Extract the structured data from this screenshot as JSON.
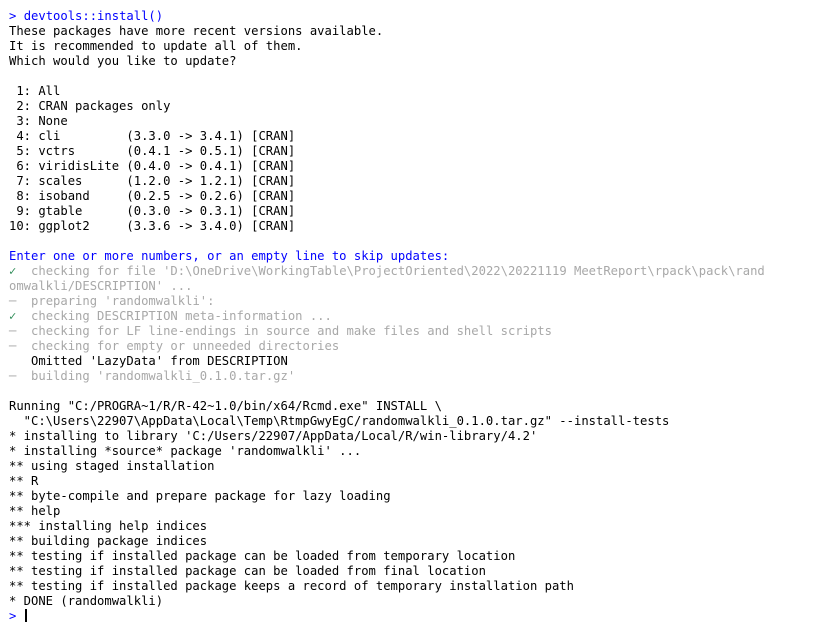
{
  "console": {
    "command_prompt": "> ",
    "command": "devtools::install()",
    "intro_lines": [
      "These packages have more recent versions available.",
      "It is recommended to update all of them.",
      "Which would you like to update?"
    ],
    "options": [
      " 1: All",
      " 2: CRAN packages only",
      " 3: None",
      " 4: cli         (3.3.0 -> 3.4.1) [CRAN]",
      " 5: vctrs       (0.4.1 -> 0.5.1) [CRAN]",
      " 6: viridisLite (0.4.0 -> 0.4.1) [CRAN]",
      " 7: scales      (1.2.0 -> 1.2.1) [CRAN]",
      " 8: isoband     (0.2.5 -> 0.2.6) [CRAN]",
      " 9: gtable      (0.3.0 -> 0.3.1) [CRAN]",
      "10: ggplot2     (3.3.6 -> 3.4.0) [CRAN]"
    ],
    "enter_prompt": "Enter one or more numbers, or an empty line to skip updates:",
    "build_steps": {
      "s1_symbol": "✓",
      "s1_text": "  checking for file 'D:\\OneDrive\\WorkingTable\\ProjectOriented\\2022\\20221119 MeetReport\\rpack\\pack\\rand",
      "s1_cont": "omwalkli/DESCRIPTION' ...",
      "s2_symbol": "─",
      "s2_text": "  preparing 'randomwalkli':",
      "s3_symbol": "✓",
      "s3_text": "  checking DESCRIPTION meta-information ...",
      "s4_symbol": "─",
      "s4_text": "  checking for LF line-endings in source and make files and shell scripts",
      "s5_symbol": "─",
      "s5_text": "  checking for empty or unneeded directories",
      "s6_text": "   Omitted 'LazyData' from DESCRIPTION",
      "s7_symbol": "─",
      "s7_text": "  building 'randomwalkli_0.1.0.tar.gz'"
    },
    "install_lines": [
      "Running \"C:/PROGRA~1/R/R-42~1.0/bin/x64/Rcmd.exe\" INSTALL \\",
      "  \"C:\\Users\\22907\\AppData\\Local\\Temp\\RtmpGwyEgC/randomwalkli_0.1.0.tar.gz\" --install-tests",
      "* installing to library 'C:/Users/22907/AppData/Local/R/win-library/4.2'",
      "* installing *source* package 'randomwalkli' ...",
      "** using staged installation",
      "** R",
      "** byte-compile and prepare package for lazy loading",
      "** help",
      "*** installing help indices",
      "** building package indices",
      "** testing if installed package can be loaded from temporary location",
      "** testing if installed package can be loaded from final location",
      "** testing if installed package keeps a record of temporary installation path",
      "* DONE (randomwalkli)"
    ],
    "final_prompt": "> "
  },
  "colors": {
    "prompt": "#0000ff",
    "check": "#2e8b57",
    "muted": "#a8a8a8"
  }
}
